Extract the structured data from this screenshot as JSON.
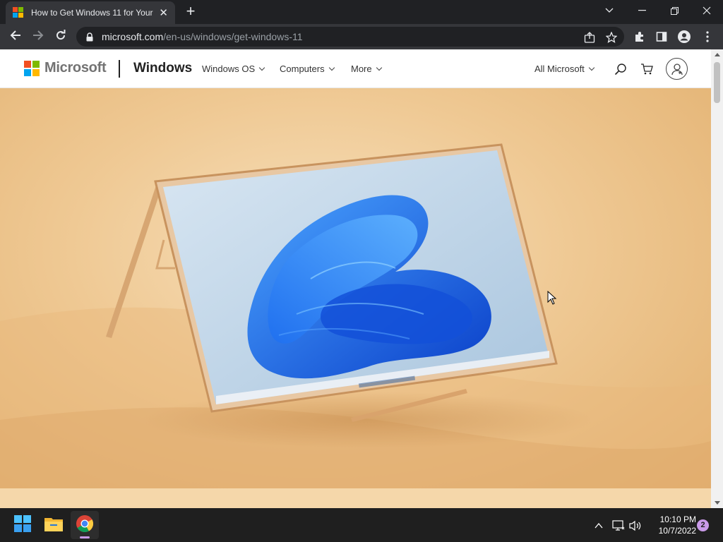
{
  "browser": {
    "tab": {
      "title": "How to Get Windows 11 for Your",
      "close_glyph": "✕"
    },
    "new_tab_glyph": "+",
    "url": {
      "host": "microsoft.com",
      "path": "/en-us/windows/get-windows-11"
    }
  },
  "page": {
    "brand": "Microsoft",
    "product": "Windows",
    "nav": [
      {
        "label": "Windows OS"
      },
      {
        "label": "Computers"
      },
      {
        "label": "More"
      }
    ],
    "all_microsoft": "All Microsoft",
    "hero_alt": "Laptop in tent mode showing Windows 11 bloom wallpaper"
  },
  "taskbar": {
    "time": "10:10 PM",
    "date": "10/7/2022",
    "notification_count": "2"
  },
  "colors": {
    "ms_red": "#f25022",
    "ms_green": "#7fba00",
    "ms_blue": "#00a4ef",
    "ms_yellow": "#ffb900",
    "win_blue": "#2f7fe8"
  },
  "icons": [
    "back-arrow-icon",
    "forward-arrow-icon",
    "reload-icon",
    "lock-icon",
    "share-icon",
    "star-icon",
    "extensions-icon",
    "sidepanel-icon",
    "profile-icon",
    "menu-icon",
    "search-icon",
    "cart-icon",
    "account-icon",
    "windows-start-icon",
    "file-explorer-icon",
    "chrome-icon",
    "chevron-up-icon",
    "network-icon",
    "volume-icon"
  ]
}
